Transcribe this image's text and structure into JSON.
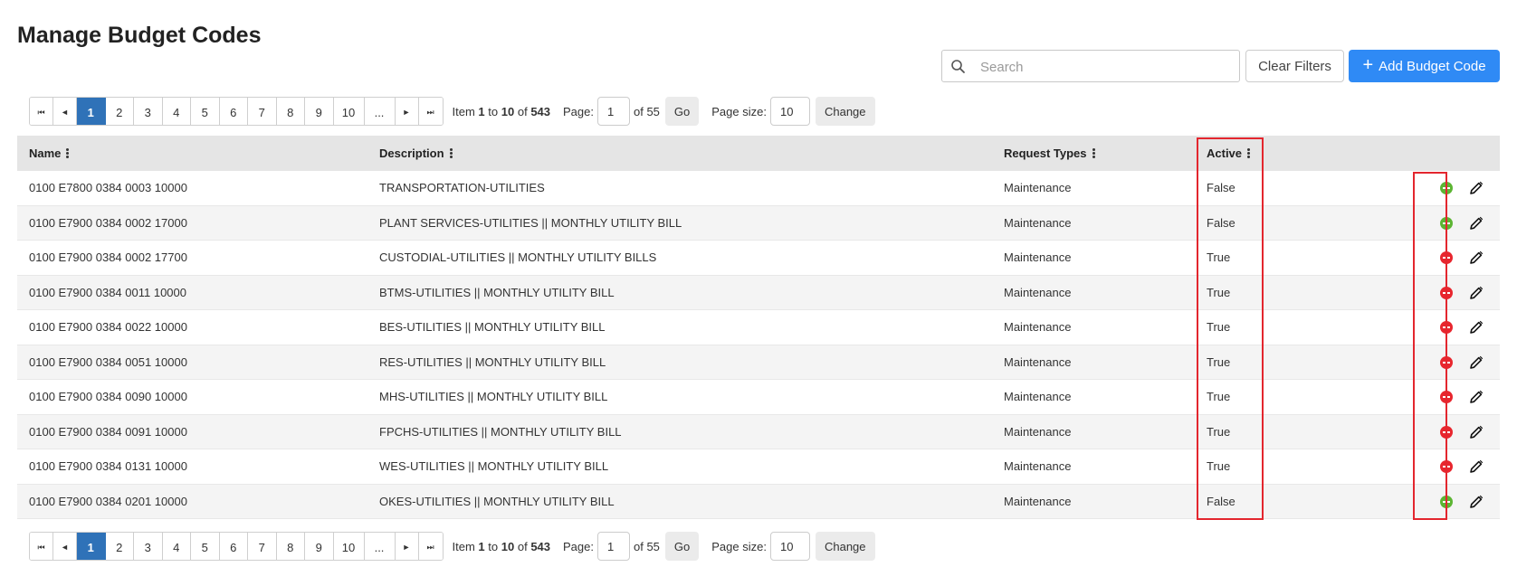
{
  "page": {
    "title": "Manage Budget Codes"
  },
  "toolbar": {
    "search_placeholder": "Search",
    "clear_label": "Clear Filters",
    "add_label": "Add Budget Code",
    "add_icon": "+"
  },
  "pager": {
    "first_icon": "⏮",
    "prev_icon": "◄",
    "next_icon": "►",
    "last_icon": "⏭",
    "pages": [
      "1",
      "2",
      "3",
      "4",
      "5",
      "6",
      "7",
      "8",
      "9",
      "10",
      "..."
    ],
    "current_page": "1",
    "item_prefix": "Item",
    "item_from": "1",
    "item_to_word": "to",
    "item_to": "10",
    "item_of_word": "of",
    "item_total": "543",
    "page_label": "Page:",
    "page_value": "1",
    "page_of": "of 55",
    "go_label": "Go",
    "size_label": "Page size:",
    "size_value": "10",
    "change_label": "Change"
  },
  "grid": {
    "columns": [
      "Name",
      "Description",
      "Request Types",
      "Active"
    ],
    "rows": [
      {
        "name": "0100 E7800 0384 0003 10000",
        "description": "TRANSPORTATION-UTILITIES",
        "request_types": "Maintenance",
        "active": "False",
        "action": "activate"
      },
      {
        "name": "0100 E7900 0384 0002 17000",
        "description": "PLANT SERVICES-UTILITIES || MONTHLY UTILITY BILL",
        "request_types": "Maintenance",
        "active": "False",
        "action": "activate"
      },
      {
        "name": "0100 E7900 0384 0002 17700",
        "description": "CUSTODIAL-UTILITIES || MONTHLY UTILITY BILLS",
        "request_types": "Maintenance",
        "active": "True",
        "action": "deactivate"
      },
      {
        "name": "0100 E7900 0384 0011 10000",
        "description": "BTMS-UTILITIES || MONTHLY UTILITY BILL",
        "request_types": "Maintenance",
        "active": "True",
        "action": "deactivate"
      },
      {
        "name": "0100 E7900 0384 0022 10000",
        "description": "BES-UTILITIES || MONTHLY UTILITY BILL",
        "request_types": "Maintenance",
        "active": "True",
        "action": "deactivate"
      },
      {
        "name": "0100 E7900 0384 0051 10000",
        "description": "RES-UTILITIES || MONTHLY UTILITY BILL",
        "request_types": "Maintenance",
        "active": "True",
        "action": "deactivate"
      },
      {
        "name": "0100 E7900 0384 0090 10000",
        "description": "MHS-UTILITIES || MONTHLY UTILITY BILL",
        "request_types": "Maintenance",
        "active": "True",
        "action": "deactivate"
      },
      {
        "name": "0100 E7900 0384 0091 10000",
        "description": "FPCHS-UTILITIES || MONTHLY UTILITY BILL",
        "request_types": "Maintenance",
        "active": "True",
        "action": "deactivate"
      },
      {
        "name": "0100 E7900 0384 0131 10000",
        "description": "WES-UTILITIES || MONTHLY UTILITY BILL",
        "request_types": "Maintenance",
        "active": "True",
        "action": "deactivate"
      },
      {
        "name": "0100 E7900 0384 0201 10000",
        "description": "OKES-UTILITIES || MONTHLY UTILITY BILL",
        "request_types": "Maintenance",
        "active": "False",
        "action": "activate"
      }
    ]
  },
  "colors": {
    "primary": "#2f8af5",
    "pager_active": "#2f72b8",
    "activate_icon": "#5cb533",
    "deactivate_icon": "#e8262e",
    "highlight": "#e3262e",
    "header_bg": "#e5e5e5"
  }
}
